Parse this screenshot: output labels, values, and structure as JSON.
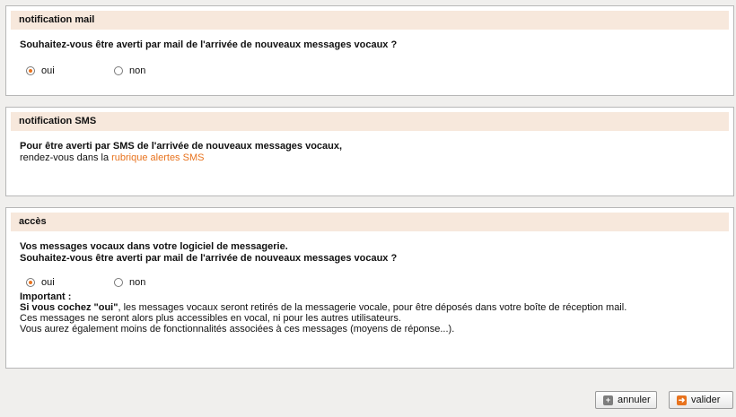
{
  "mail_section": {
    "title": "notification mail",
    "question": "Souhaitez-vous être averti par mail de l'arrivée de nouveaux messages vocaux ?",
    "option_yes": "oui",
    "option_no": "non",
    "selected": "oui"
  },
  "sms_section": {
    "title": "notification SMS",
    "line1": "Pour être averti par SMS de l'arrivée de nouveaux messages vocaux,",
    "line2_prefix": "rendez-vous dans la ",
    "link_text": "rubrique alertes SMS"
  },
  "access_section": {
    "title": "accès",
    "intro_line1": "Vos messages vocaux dans votre logiciel de messagerie.",
    "intro_line2": "Souhaitez-vous être averti par mail de l'arrivée de nouveaux messages vocaux ?",
    "option_yes": "oui",
    "option_no": "non",
    "selected": "oui",
    "important_title": "Important :",
    "note_bold": "Si vous cochez \"oui\"",
    "note_rest": ", les messages vocaux seront retirés de la messagerie vocale, pour être déposés dans votre boîte de réception mail.",
    "note_line2": "Ces messages ne seront alors plus accessibles en vocal, ni pour les autres utilisateurs.",
    "note_line3": "Vous aurez également moins de fonctionnalités associées à ces messages (moyens de réponse...)."
  },
  "buttons": {
    "cancel_label": "annuler",
    "submit_label": "valider"
  },
  "colors": {
    "accent": "#e8731e",
    "header_bg": "#f7e8dc"
  },
  "icons": {
    "cancel": "plus-icon",
    "submit": "arrow-right-icon"
  }
}
